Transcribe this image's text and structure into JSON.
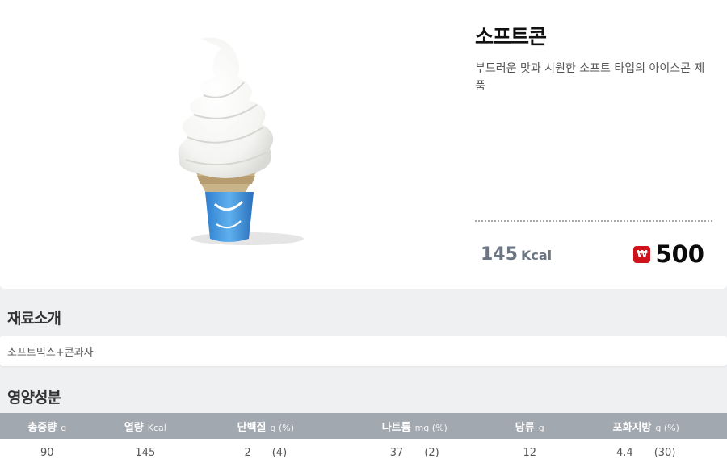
{
  "product": {
    "name": "소프트콘",
    "description": "부드러운 맛과 시원한 소프트 타입의 아이스콘 제품",
    "kcal_value": "145",
    "kcal_unit": "Kcal",
    "price_icon": "₩",
    "price": "500"
  },
  "ingredients": {
    "title": "재료소개",
    "text": "소프트믹스+콘과자"
  },
  "nutrition": {
    "title": "영양성분",
    "headers": [
      {
        "label": "총중량",
        "unit": "g"
      },
      {
        "label": "열량",
        "unit": "Kcal"
      },
      {
        "label": "단백질",
        "unit": "g (%)"
      },
      {
        "label": "나트륨",
        "unit": "mg (%)"
      },
      {
        "label": "당류",
        "unit": "g"
      },
      {
        "label": "포화지방",
        "unit": "g (%)"
      }
    ],
    "values": [
      {
        "value": "90",
        "pct": ""
      },
      {
        "value": "145",
        "pct": ""
      },
      {
        "value": "2",
        "pct": "(4)"
      },
      {
        "value": "37",
        "pct": "(2)"
      },
      {
        "value": "12",
        "pct": ""
      },
      {
        "value": "4.4",
        "pct": "(30)"
      }
    ]
  },
  "icons": {
    "product_image": "soft-cone-ice-cream",
    "won": "won-currency-icon"
  },
  "colors": {
    "price_badge": "#d0131a",
    "table_header": "#a2a8b0",
    "kcal": "#6c7683"
  }
}
